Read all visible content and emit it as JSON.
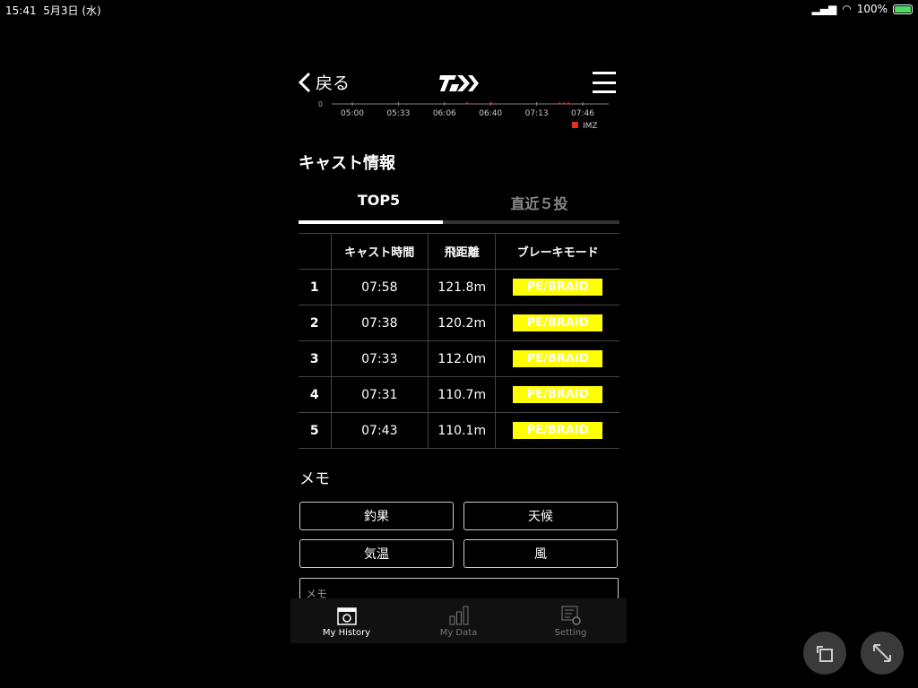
{
  "status": {
    "time": "15:41",
    "date": "5月3日 (水)",
    "battery": "100%"
  },
  "nav": {
    "back_label": "戻る"
  },
  "chart_data": {
    "type": "scatter",
    "y_ticks": [
      "0"
    ],
    "x_ticks": [
      "05:00",
      "05:33",
      "06:06",
      "06:40",
      "07:13",
      "07:46"
    ],
    "legend": [
      "IMZ"
    ],
    "series_color": "#e0301e",
    "legend_placement": "bottom-right"
  },
  "cast": {
    "title": "キャスト情報",
    "tabs": [
      {
        "label": "TOP5",
        "active": true
      },
      {
        "label": "直近５投",
        "active": false
      }
    ],
    "headers": [
      "",
      "キャスト時間",
      "飛距離",
      "ブレーキモード"
    ],
    "rows": [
      {
        "rank": "1",
        "time": "07:58",
        "distance": "121.8m",
        "mode": "PE/BRAID"
      },
      {
        "rank": "2",
        "time": "07:38",
        "distance": "120.2m",
        "mode": "PE/BRAID"
      },
      {
        "rank": "3",
        "time": "07:33",
        "distance": "112.0m",
        "mode": "PE/BRAID"
      },
      {
        "rank": "4",
        "time": "07:31",
        "distance": "110.7m",
        "mode": "PE/BRAID"
      },
      {
        "rank": "5",
        "time": "07:43",
        "distance": "110.1m",
        "mode": "PE/BRAID"
      }
    ]
  },
  "memo": {
    "title": "メモ",
    "buttons": [
      "釣果",
      "天候",
      "気温",
      "風"
    ],
    "placeholder": "メモ"
  },
  "bottom": {
    "items": [
      {
        "label": "My History",
        "icon": "calendar-history-icon"
      },
      {
        "label": "My Data",
        "icon": "bar-chart-icon"
      },
      {
        "label": "Setting",
        "icon": "settings-icon"
      }
    ]
  },
  "colors": {
    "badge": "#ffff00",
    "legend": "#e0301e"
  }
}
